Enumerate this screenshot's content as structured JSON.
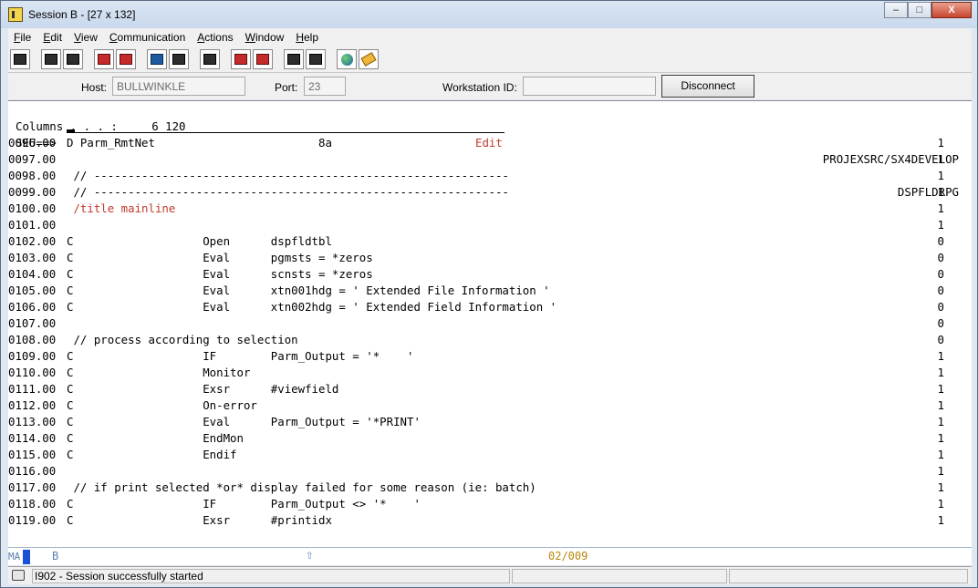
{
  "window": {
    "title": "Session B - [27 x 132]"
  },
  "window_controls": {
    "minimize": "–",
    "maximize": "□",
    "close": "X"
  },
  "menu": {
    "items": [
      {
        "label": "File",
        "accel": "F",
        "rest": "ile"
      },
      {
        "label": "Edit",
        "accel": "E",
        "rest": "dit"
      },
      {
        "label": "View",
        "accel": "V",
        "rest": "iew"
      },
      {
        "label": "Communication",
        "accel": "C",
        "rest": "ommunication"
      },
      {
        "label": "Actions",
        "accel": "A",
        "rest": "ctions"
      },
      {
        "label": "Window",
        "accel": "W",
        "rest": "indow"
      },
      {
        "label": "Help",
        "accel": "H",
        "rest": "elp"
      }
    ]
  },
  "toolbar": {
    "icons": [
      "print-screen-icon",
      "copy-icon",
      "paste-icon",
      "send-file-icon",
      "receive-file-icon",
      "display-session-icon",
      "keyboard-map-icon",
      "macro-icon",
      "record-macro-icon",
      "stop-macro-icon",
      "play-macro-icon",
      "quick-macro-icon",
      "globe-icon",
      "help-key-icon"
    ]
  },
  "hostbar": {
    "host_label": "Host:",
    "host_value": "BULLWINKLE",
    "port_label": "Port:",
    "port_value": "23",
    "workstation_label": "Workstation ID:",
    "workstation_value": "",
    "disconnect_label": "Disconnect"
  },
  "screen": {
    "columns_text": "Columns . . . :     6 120",
    "mode": "Edit",
    "library_file": "PROJEXSRC/SX4DEVELOP",
    "seu_prompt": "SEU==>",
    "member": "DSPFLDRPG",
    "lines": [
      {
        "seq": "0096.00",
        "text": "D Parm_RmtNet                        8a",
        "flag": "1",
        "red": false
      },
      {
        "seq": "0097.00",
        "text": "",
        "flag": "1",
        "red": false
      },
      {
        "seq": "0098.00",
        "text": " // -------------------------------------------------------------",
        "flag": "1",
        "red": false
      },
      {
        "seq": "0099.00",
        "text": " // -------------------------------------------------------------",
        "flag": "1",
        "red": false
      },
      {
        "seq": "0100.00",
        "text": " /title mainline",
        "flag": "1",
        "red": true
      },
      {
        "seq": "0101.00",
        "text": "",
        "flag": "1",
        "red": false
      },
      {
        "seq": "0102.00",
        "text": "C                   Open      dspfldtbl",
        "flag": "0",
        "red": false
      },
      {
        "seq": "0103.00",
        "text": "C                   Eval      pgmsts = *zeros",
        "flag": "0",
        "red": false
      },
      {
        "seq": "0104.00",
        "text": "C                   Eval      scnsts = *zeros",
        "flag": "0",
        "red": false
      },
      {
        "seq": "0105.00",
        "text": "C                   Eval      xtn001hdg = ' Extended File Information '",
        "flag": "0",
        "red": false
      },
      {
        "seq": "0106.00",
        "text": "C                   Eval      xtn002hdg = ' Extended Field Information '",
        "flag": "0",
        "red": false
      },
      {
        "seq": "0107.00",
        "text": "",
        "flag": "0",
        "red": false
      },
      {
        "seq": "0108.00",
        "text": " // process according to selection",
        "flag": "0",
        "red": false
      },
      {
        "seq": "0109.00",
        "text": "C                   IF        Parm_Output = '*    '",
        "flag": "1",
        "red": false
      },
      {
        "seq": "0110.00",
        "text": "C                   Monitor",
        "flag": "1",
        "red": false
      },
      {
        "seq": "0111.00",
        "text": "C                   Exsr      #viewfield",
        "flag": "1",
        "red": false
      },
      {
        "seq": "0112.00",
        "text": "C                   On-error",
        "flag": "1",
        "red": false
      },
      {
        "seq": "0113.00",
        "text": "C                   Eval      Parm_Output = '*PRINT'",
        "flag": "1",
        "red": false
      },
      {
        "seq": "0114.00",
        "text": "C                   EndMon",
        "flag": "1",
        "red": false
      },
      {
        "seq": "0115.00",
        "text": "C                   Endif",
        "flag": "1",
        "red": false
      },
      {
        "seq": "0116.00",
        "text": "",
        "flag": "1",
        "red": false
      },
      {
        "seq": "0117.00",
        "text": " // if print selected *or* display failed for some reason (ie: batch)",
        "flag": "1",
        "red": false
      },
      {
        "seq": "0118.00",
        "text": "C                   IF        Parm_Output <> '*    '",
        "flag": "1",
        "red": false
      },
      {
        "seq": "0119.00",
        "text": "C                   Exsr      #printidx",
        "flag": "1",
        "red": false
      }
    ]
  },
  "oia": {
    "ma": "MA",
    "session": "B",
    "arrow": "⇧",
    "cursor_pos": "02/009"
  },
  "status": {
    "message": "I902 - Session successfully started"
  },
  "colors": {
    "keyword_red": "#c0392b",
    "cursor_pos": "#b8860b",
    "oia_blue": "#1a4fd6"
  }
}
